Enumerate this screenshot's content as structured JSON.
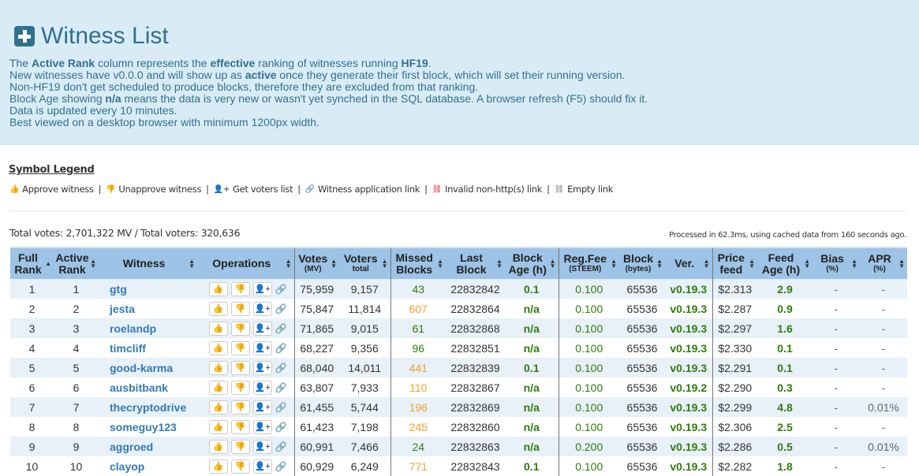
{
  "header": {
    "title": "Witness List",
    "intro": [
      [
        "The ",
        {
          "b": "Active Rank"
        },
        " column represents the ",
        {
          "b": "effective"
        },
        " ranking of witnesses running ",
        {
          "b": "HF19"
        },
        "."
      ],
      [
        "New witnesses have v0.0.0 and will show up as ",
        {
          "b": "active"
        },
        " once they generate their first block, which will set their running version."
      ],
      [
        "Non-HF19 don't get scheduled to produce blocks, therefore they are excluded from that ranking."
      ],
      [
        "Block Age showing ",
        {
          "b": "n/a"
        },
        " means the data is very new or wasn't yet synched in the SQL database. A browser refresh (F5) should fix it."
      ],
      [
        "Data is updated every 10 minutes."
      ],
      [
        "Best viewed on a desktop browser with minimum 1200px width."
      ]
    ]
  },
  "legend": {
    "title": "Symbol Legend",
    "items": [
      {
        "icon": "thumbs-up-icon",
        "label": "Approve witness"
      },
      {
        "icon": "thumbs-down-icon",
        "label": "Unapprove witness"
      },
      {
        "icon": "user-plus-icon",
        "label": "Get voters list"
      },
      {
        "icon": "link-icon",
        "label": "Witness application link"
      },
      {
        "icon": "broken-link-red-icon",
        "label": "Invalid non-http(s) link"
      },
      {
        "icon": "broken-link-gray-icon",
        "label": "Empty link"
      }
    ]
  },
  "totals": "Total votes: 2,701,322 MV / Total voters: 320,636",
  "processed": "Processed in 62.3ms, using cached data from 160 seconds ago.",
  "columns": [
    {
      "l1": "Full",
      "l2": "Rank"
    },
    {
      "l1": "Active",
      "l2": "Rank"
    },
    {
      "l1": "Witness"
    },
    {
      "l1": "Operations"
    },
    {
      "l1": "Votes",
      "sub": "(MV)"
    },
    {
      "l1": "Voters",
      "sub": "total"
    },
    {
      "l1": "Missed",
      "l2": "Blocks"
    },
    {
      "l1": "Last",
      "l2": "Block"
    },
    {
      "l1": "Block",
      "l2": "Age (h)"
    },
    {
      "l1": "Reg.Fee",
      "sub": "(STEEM)"
    },
    {
      "l1": "Block",
      "sub": "(bytes)"
    },
    {
      "l1": "Ver."
    },
    {
      "l1": "Price",
      "l2": "feed"
    },
    {
      "l1": "Feed",
      "l2": "Age (h)"
    },
    {
      "l1": "Bias",
      "sub": "(%)"
    },
    {
      "l1": "APR",
      "sub": "(%)"
    }
  ],
  "rows": [
    [
      "1",
      "1",
      "gtg",
      "75,959",
      "9,157",
      "43",
      "22832842",
      "0.1",
      "0.100",
      "65536",
      "v0.19.3",
      "$2.313",
      "2.9",
      "-",
      "-"
    ],
    [
      "2",
      "2",
      "jesta",
      "75,847",
      "11,814",
      "607",
      "22832864",
      "n/a",
      "0.100",
      "65536",
      "v0.19.3",
      "$2.287",
      "0.9",
      "-",
      "-"
    ],
    [
      "3",
      "3",
      "roelandp",
      "71,865",
      "9,015",
      "61",
      "22832868",
      "n/a",
      "0.100",
      "65536",
      "v0.19.3",
      "$2.297",
      "1.6",
      "-",
      "-"
    ],
    [
      "4",
      "4",
      "timcliff",
      "68,227",
      "9,356",
      "96",
      "22832851",
      "n/a",
      "0.100",
      "65536",
      "v0.19.3",
      "$2.330",
      "0.1",
      "-",
      "-"
    ],
    [
      "5",
      "5",
      "good-karma",
      "68,040",
      "14,011",
      "441",
      "22832839",
      "0.1",
      "0.100",
      "65536",
      "v0.19.3",
      "$2.291",
      "0.1",
      "-",
      "-"
    ],
    [
      "6",
      "6",
      "ausbitbank",
      "63,807",
      "7,933",
      "110",
      "22832867",
      "n/a",
      "0.100",
      "65536",
      "v0.19.2",
      "$2.290",
      "0.3",
      "-",
      "-"
    ],
    [
      "7",
      "7",
      "thecryptodrive",
      "61,455",
      "5,744",
      "196",
      "22832869",
      "n/a",
      "0.100",
      "65536",
      "v0.19.3",
      "$2.299",
      "4.8",
      "-",
      "0.01%"
    ],
    [
      "8",
      "8",
      "someguy123",
      "61,423",
      "7,198",
      "245",
      "22832860",
      "n/a",
      "0.100",
      "65536",
      "v0.19.3",
      "$2.306",
      "2.5",
      "-",
      "-"
    ],
    [
      "9",
      "9",
      "aggroed",
      "60,991",
      "7,466",
      "24",
      "22832863",
      "n/a",
      "0.200",
      "65536",
      "v0.19.3",
      "$2.286",
      "0.5",
      "-",
      "0.01%"
    ],
    [
      "10",
      "10",
      "clayop",
      "60,929",
      "6,249",
      "771",
      "22832843",
      "0.1",
      "0.100",
      "65536",
      "v0.19.3",
      "$2.282",
      "1.8",
      "-",
      "-"
    ]
  ],
  "missed_warn_threshold": 100,
  "colors": {
    "accent": "#31708f",
    "link": "#337ab7",
    "green": "#2f7d0e",
    "orange": "#f3a32a",
    "header": "#9dc3e6"
  }
}
